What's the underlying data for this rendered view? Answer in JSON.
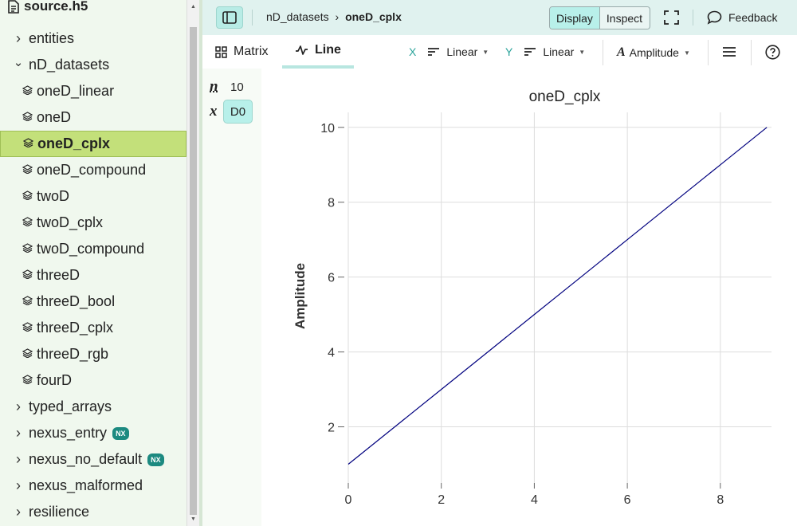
{
  "file": {
    "name": "source.h5"
  },
  "tree": [
    {
      "label": "entities",
      "type": "group",
      "expanded": false
    },
    {
      "label": "nD_datasets",
      "type": "group",
      "expanded": true
    },
    {
      "label": "oneD_linear",
      "type": "dataset"
    },
    {
      "label": "oneD",
      "type": "dataset"
    },
    {
      "label": "oneD_cplx",
      "type": "dataset",
      "selected": true
    },
    {
      "label": "oneD_compound",
      "type": "dataset"
    },
    {
      "label": "twoD",
      "type": "dataset"
    },
    {
      "label": "twoD_cplx",
      "type": "dataset"
    },
    {
      "label": "twoD_compound",
      "type": "dataset"
    },
    {
      "label": "threeD",
      "type": "dataset"
    },
    {
      "label": "threeD_bool",
      "type": "dataset"
    },
    {
      "label": "threeD_cplx",
      "type": "dataset"
    },
    {
      "label": "threeD_rgb",
      "type": "dataset"
    },
    {
      "label": "fourD",
      "type": "dataset"
    },
    {
      "label": "typed_arrays",
      "type": "group",
      "expanded": false
    },
    {
      "label": "nexus_entry",
      "type": "group",
      "expanded": false,
      "badge": "NX"
    },
    {
      "label": "nexus_no_default",
      "type": "group",
      "expanded": false,
      "badge": "NX"
    },
    {
      "label": "nexus_malformed",
      "type": "group",
      "expanded": false
    },
    {
      "label": "resilience",
      "type": "group",
      "expanded": false
    }
  ],
  "breadcrumb": {
    "parent": "nD_datasets",
    "separator": "›",
    "current": "oneD_cplx"
  },
  "mode": {
    "display": "Display",
    "inspect": "Inspect",
    "active": "Display"
  },
  "feedback_label": "Feedback",
  "tabs": {
    "matrix": "Matrix",
    "line": "Line",
    "active": "Line"
  },
  "controls": {
    "x_label": "X",
    "x_scale": "Linear",
    "y_label": "Y",
    "y_scale": "Linear",
    "complex_mode": "Amplitude"
  },
  "dims": {
    "n_label": "n",
    "n_value": "10",
    "x_label": "x",
    "x_value": "D0"
  },
  "colors": {
    "accent": "#b8f0ea",
    "selected": "#c3e07a",
    "line": "#00007f",
    "sidebar": "#f0f8ee"
  },
  "chart_data": {
    "type": "line",
    "title": "oneD_cplx",
    "xlabel": "",
    "ylabel": "Amplitude",
    "x": [
      0,
      1,
      2,
      3,
      4,
      5,
      6,
      7,
      8,
      9
    ],
    "series": [
      {
        "values": [
          1,
          2,
          3,
          4,
          5,
          6,
          7,
          8,
          9,
          10
        ]
      }
    ],
    "xlim": [
      0,
      9.1
    ],
    "ylim": [
      0.5,
      10.4
    ],
    "xticks": [
      0,
      2,
      4,
      6,
      8
    ],
    "yticks": [
      2,
      4,
      6,
      8,
      10
    ],
    "grid": true
  }
}
